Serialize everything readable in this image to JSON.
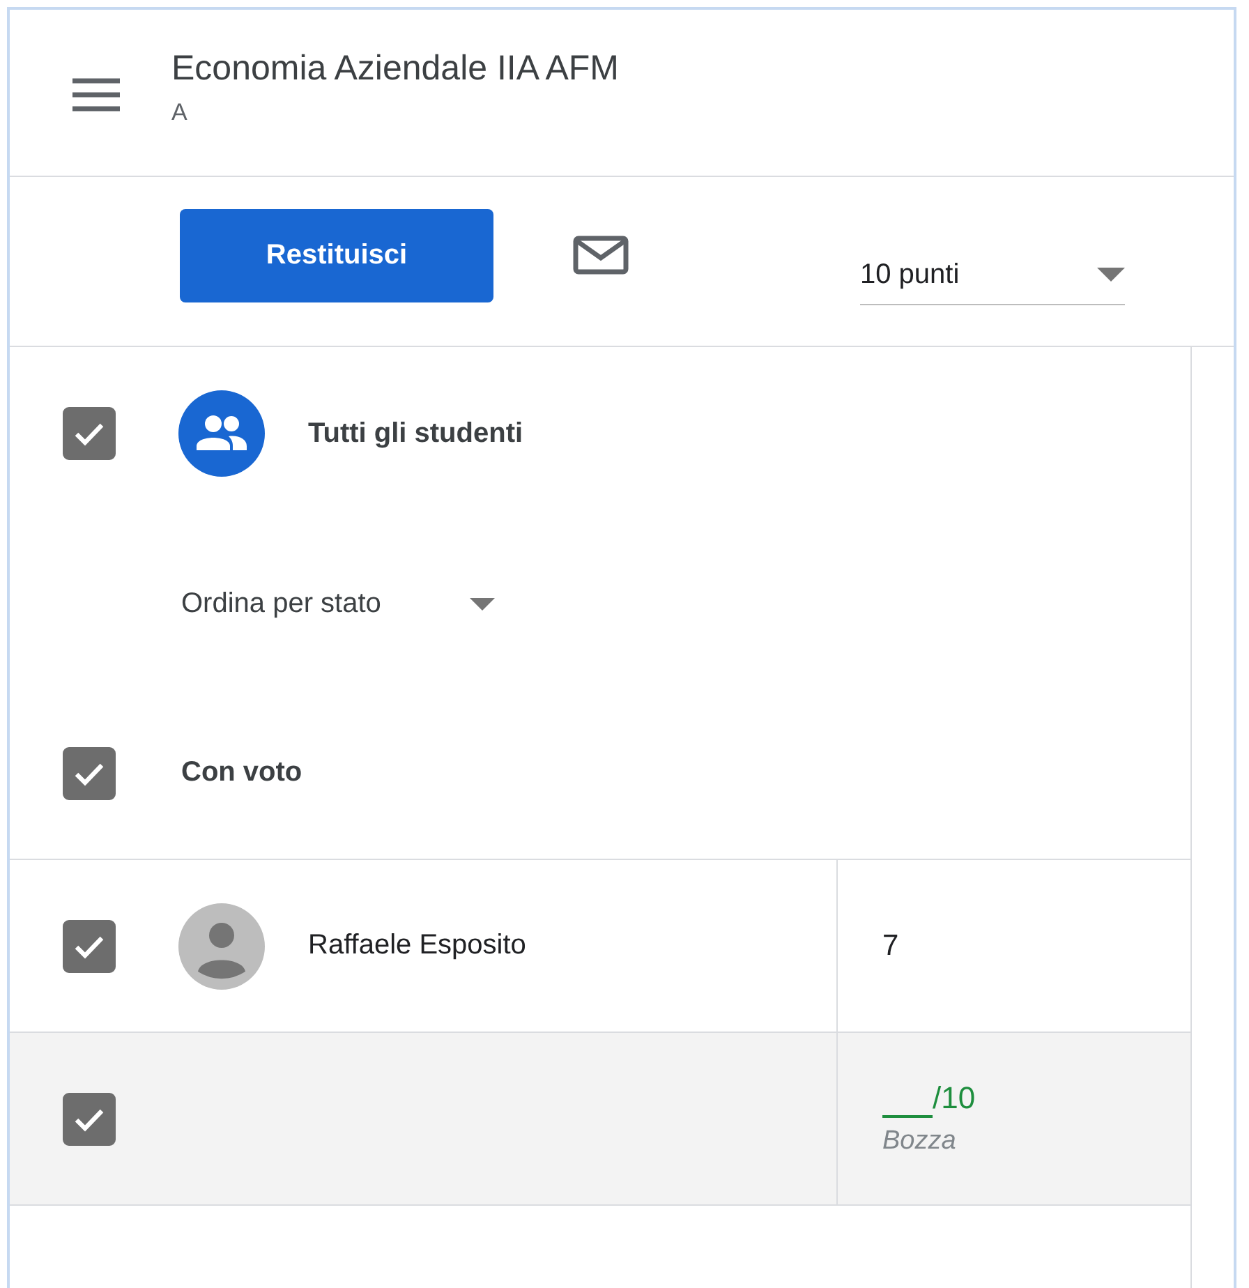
{
  "header": {
    "title": "Economia Aziendale IIA AFM",
    "subtitle": "A"
  },
  "toolbar": {
    "return_button": "Restituisci",
    "points_dropdown": {
      "value": "10 punti"
    }
  },
  "all_students": {
    "label": "Tutti gli studenti",
    "checked": true
  },
  "sort_dropdown": {
    "value": "Ordina per stato"
  },
  "group": {
    "label": "Con voto",
    "checked": true
  },
  "rows": [
    {
      "kind": "student",
      "name": "Raffaele Esposito",
      "checked": true,
      "grade": "7"
    },
    {
      "kind": "draft",
      "checked": true,
      "grade_max": "/10",
      "status": "Bozza"
    }
  ]
}
